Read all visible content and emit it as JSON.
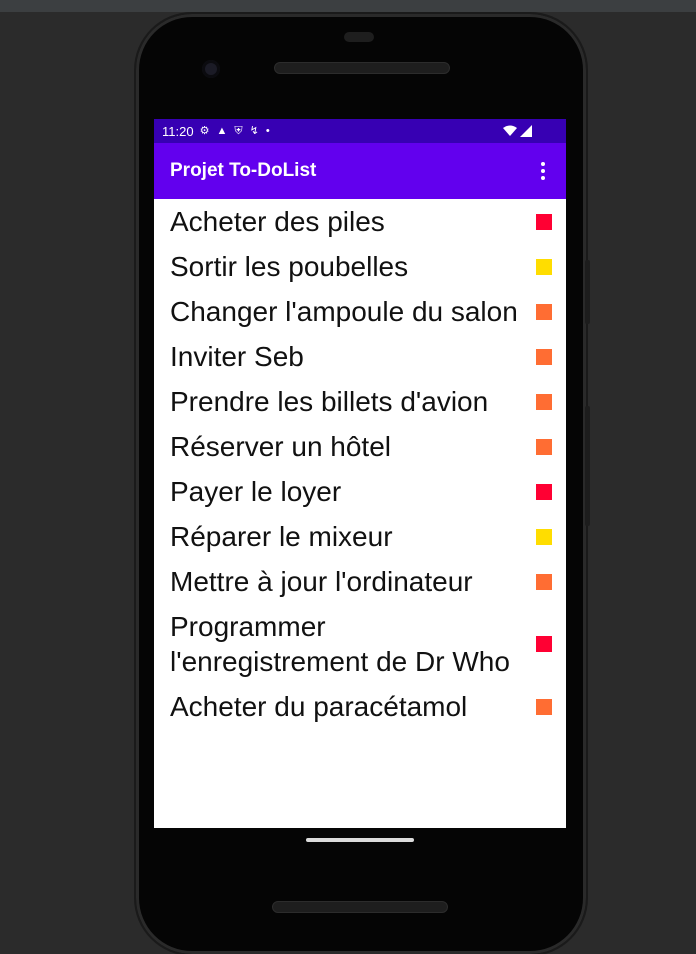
{
  "status_bar": {
    "time": "11:20",
    "left_icons": [
      "settings-icon",
      "a-icon",
      "shield-icon",
      "usb-icon",
      "dot-icon"
    ],
    "right_icons": [
      "wifi-icon",
      "signal-icon"
    ]
  },
  "app_bar": {
    "title": "Projet To-DoList",
    "menu_icon": "more-vert-icon"
  },
  "colors": {
    "status_bar": "#3700b3",
    "app_bar": "#6200ee",
    "priority_high": "#ff0033",
    "priority_medium": "#ff6d33",
    "priority_low": "#ffdd00"
  },
  "todos": [
    {
      "label": "Acheter des piles",
      "priority": "high"
    },
    {
      "label": "Sortir les poubelles",
      "priority": "low"
    },
    {
      "label": "Changer l'ampoule du salon",
      "priority": "medium"
    },
    {
      "label": "Inviter Seb",
      "priority": "medium"
    },
    {
      "label": "Prendre les billets d'avion",
      "priority": "medium"
    },
    {
      "label": "Réserver un hôtel",
      "priority": "medium"
    },
    {
      "label": "Payer le loyer",
      "priority": "high"
    },
    {
      "label": "Réparer le mixeur",
      "priority": "low"
    },
    {
      "label": "Mettre à jour l'ordinateur",
      "priority": "medium"
    },
    {
      "label": "Programmer l'enregistrement de Dr Who",
      "priority": "high"
    },
    {
      "label": "Acheter du paracétamol",
      "priority": "medium"
    }
  ]
}
